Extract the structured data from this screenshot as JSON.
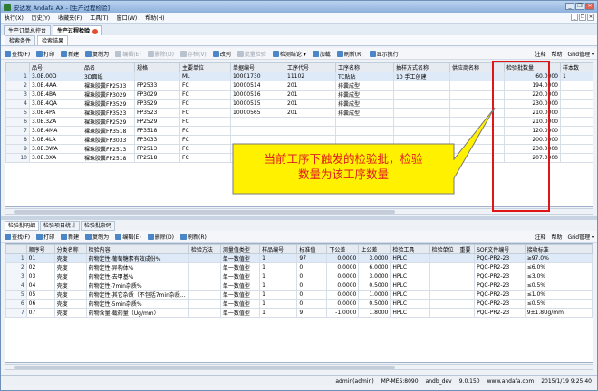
{
  "window": {
    "title": "安达发 Andafa AX - [生产过程检验]",
    "min": "_",
    "restore": "❐",
    "close": "✕"
  },
  "menu": [
    "执行(X)",
    "历史(Y)",
    "收藏夹(F)",
    "工具(T)",
    "窗口(W)",
    "帮助(H)"
  ],
  "doc_tabs": [
    "生产订单总控台",
    "生产过程检验"
  ],
  "sub_tabs": [
    "检索条件",
    "检索结果"
  ],
  "toolbar_top": {
    "items": [
      {
        "label": "查找(F)",
        "enabled": true
      },
      {
        "label": "打印",
        "enabled": true
      },
      {
        "label": "新建",
        "enabled": true
      },
      {
        "label": "复制为",
        "enabled": true
      },
      {
        "label": "编辑(E)",
        "enabled": false
      },
      {
        "label": "删除(D)",
        "enabled": false
      },
      {
        "label": "存档(V)",
        "enabled": false
      },
      {
        "label": "改列",
        "enabled": true
      },
      {
        "label": "批量检验",
        "enabled": false
      },
      {
        "label": "检测结论 ▾",
        "enabled": true
      },
      {
        "label": "加载",
        "enabled": true
      },
      {
        "label": "刷新(R)",
        "enabled": true
      },
      {
        "label": "显示执行",
        "enabled": true
      }
    ],
    "right": [
      "注释",
      "帮助",
      "Grid管理 ▾"
    ]
  },
  "top_grid": {
    "columns": [
      "",
      "品号",
      "品名",
      "规格",
      "主要单位",
      "单据编号",
      "工序代号",
      "工序名称",
      "抽样方式名称",
      "供应商名称",
      "检验批数量",
      "样本数"
    ],
    "rows": [
      [
        "1",
        "3.0E.00D",
        "3D面纸",
        "",
        "ML",
        "10001730",
        "11102",
        "TC贴贴",
        "10 手工创建",
        "",
        "60.0000",
        "1"
      ],
      [
        "2",
        "3.0E.4AA",
        "裸珠胶囊FP2533",
        "FP2533",
        "FC",
        "10000514",
        "201",
        "排囊成型",
        "",
        "",
        "194.0000",
        ""
      ],
      [
        "3",
        "3.0E.4BA",
        "裸珠胶囊FP3029",
        "FP3029",
        "FC",
        "10000516",
        "201",
        "排囊成型",
        "",
        "",
        "220.0000",
        ""
      ],
      [
        "4",
        "3.0E.4QA",
        "裸珠胶囊FP3529",
        "FP3529",
        "FC",
        "10000515",
        "201",
        "排囊成型",
        "",
        "",
        "230.0000",
        ""
      ],
      [
        "5",
        "3.0E.4PA",
        "裸珠胶囊FP3523",
        "FP3523",
        "FC",
        "10000565",
        "201",
        "排囊成型",
        "",
        "",
        "210.0000",
        ""
      ],
      [
        "6",
        "3.0E.3ZA",
        "裸珠胶囊FP2529",
        "FP2529",
        "FC",
        "",
        "",
        "",
        "",
        "",
        "210.0000",
        ""
      ],
      [
        "7",
        "3.0E.4MA",
        "裸珠胶囊FP3518",
        "FP3518",
        "FC",
        "",
        "",
        "",
        "",
        "",
        "120.0000",
        ""
      ],
      [
        "8",
        "3.0E.4LA",
        "裸珠胶囊FP3033",
        "FP3033",
        "FC",
        "",
        "",
        "",
        "",
        "",
        "200.0000",
        ""
      ],
      [
        "9",
        "3.0E.3WA",
        "裸珠胶囊FP2513",
        "FP2513",
        "FC",
        "",
        "",
        "",
        "",
        "",
        "230.0000",
        ""
      ],
      [
        "10",
        "3.0E.3XA",
        "裸珠胶囊FP2518",
        "FP2518",
        "FC",
        "10000517",
        "201",
        "排囊成型",
        "",
        "",
        "207.0000",
        ""
      ]
    ]
  },
  "lower_tabs": [
    "检验批明细",
    "检验项目统计",
    "检验批条码"
  ],
  "toolbar_bottom": {
    "items": [
      {
        "label": "查找(F)",
        "enabled": true
      },
      {
        "label": "打印",
        "enabled": true
      },
      {
        "label": "新建",
        "enabled": true
      },
      {
        "label": "复制为",
        "enabled": true
      },
      {
        "label": "编辑(E)",
        "enabled": true
      },
      {
        "label": "删除(D)",
        "enabled": true
      },
      {
        "label": "刷新(R)",
        "enabled": true
      }
    ],
    "right": [
      "注释",
      "帮助",
      "Grid管理 ▾"
    ]
  },
  "bottom_grid": {
    "columns": [
      "",
      "顺序号",
      "分类名称",
      "检验内容",
      "检验方法",
      "测量值类型",
      "样品编号",
      "标准值",
      "下公差",
      "上公差",
      "检验工具",
      "检验单位",
      "重要",
      "SOP文件编号",
      "接收标准"
    ],
    "rows": [
      [
        "1",
        "01",
        "壳度",
        "药物定性-葡萄糖素有效成份%",
        "",
        "单一数值型",
        "1",
        "97",
        "0.0000",
        "3.0000",
        "HPLC",
        "",
        "",
        "PQC-PR2-23",
        "≥97.0%"
      ],
      [
        "2",
        "02",
        "壳度",
        "药物定性-异构体%",
        "",
        "单一数值型",
        "1",
        "0",
        "0.0000",
        "6.0000",
        "HPLC",
        "",
        "",
        "PQC-PR2-23",
        "≤6.0%"
      ],
      [
        "3",
        "03",
        "壳度",
        "药物定性-去甲基%",
        "",
        "单一数值型",
        "1",
        "0",
        "0.0000",
        "3.0000",
        "HPLC",
        "",
        "",
        "PQC-PR2-23",
        "≤3.0%"
      ],
      [
        "4",
        "04",
        "壳度",
        "药物定性-7min杂质%",
        "",
        "单一数值型",
        "1",
        "0",
        "0.0000",
        "0.5000",
        "HPLC",
        "",
        "",
        "PQC-PR2-23",
        "≤0.5%"
      ],
      [
        "5",
        "05",
        "壳度",
        "药物定性-其它杂质（不包括7min杂质...",
        "",
        "单一数值型",
        "1",
        "0",
        "0.0000",
        "1.0000",
        "HPLC",
        "",
        "",
        "PQC-PR2-23",
        "≤1.0%"
      ],
      [
        "6",
        "06",
        "壳度",
        "药物定性-5min杂质%",
        "",
        "单一数值型",
        "1",
        "0",
        "0.0000",
        "0.5000",
        "HPLC",
        "",
        "",
        "PQC-PR2-23",
        "≤0.5%"
      ],
      [
        "7",
        "07",
        "壳度",
        "药物含量-载药量（Ug/mm）",
        "",
        "单一数值型",
        "1",
        "9",
        "-1.0000",
        "1.8000",
        "HPLC",
        "",
        "",
        "PQC-PR2-23",
        "9±1.8Ug/mm"
      ]
    ]
  },
  "status": [
    "admin(admin)",
    "MP-MES:8090",
    "andb_dev",
    "9.0.150",
    "www.andafa.com",
    "2015/1/19 9:25:40"
  ],
  "annotation": {
    "line1": "当前工序下触发的检验批，检验",
    "line2": "数量为该工序数量",
    "highlight_color": "#e01515",
    "bubble_color": "#fff100"
  }
}
